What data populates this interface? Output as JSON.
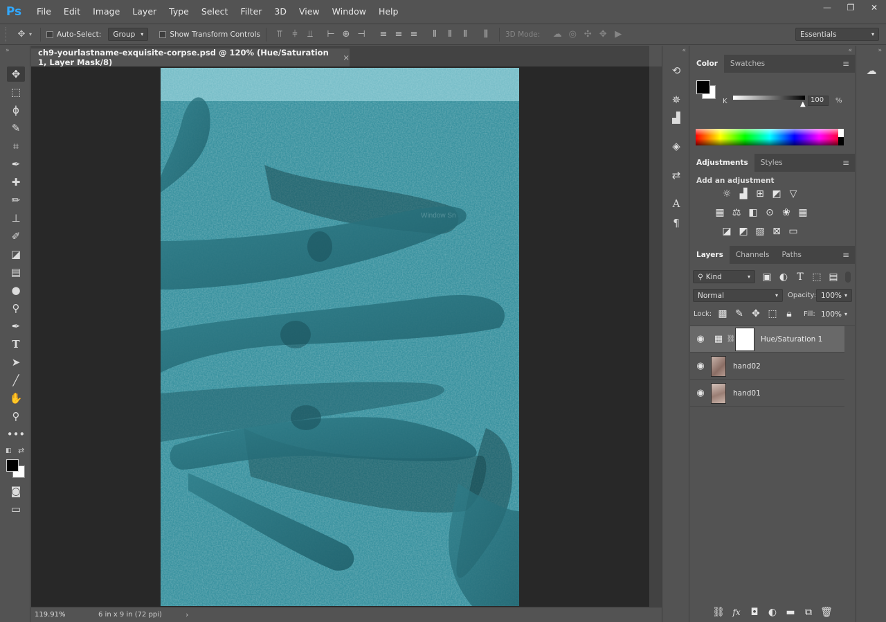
{
  "app": {
    "logo": "Ps"
  },
  "menu": [
    "File",
    "Edit",
    "Image",
    "Layer",
    "Type",
    "Select",
    "Filter",
    "3D",
    "View",
    "Window",
    "Help"
  ],
  "window_controls": {
    "minimize": "—",
    "restore": "❐",
    "close": "✕"
  },
  "options_bar": {
    "auto_select_label": "Auto-Select:",
    "auto_select_value": "Group",
    "show_transform_label": "Show Transform Controls",
    "mode_3d_label": "3D Mode:",
    "workspace": "Essentials"
  },
  "document": {
    "tab_title": "ch9-yourlastname-exquisite-corpse.psd @ 120% (Hue/Saturation 1, Layer Mask/8)",
    "close_glyph": "×",
    "zoom": "119.91%",
    "doc_info": "6 in x 9 in (72 ppi)",
    "watermark_fragment": "Window Sn"
  },
  "color_panel": {
    "tabs": [
      "Color",
      "Swatches"
    ],
    "channel_label": "K",
    "value": "100",
    "unit": "%"
  },
  "adjustments_panel": {
    "tabs": [
      "Adjustments",
      "Styles"
    ],
    "heading": "Add an adjustment"
  },
  "layers_panel": {
    "tabs": [
      "Layers",
      "Channels",
      "Paths"
    ],
    "filter_kind": "Kind",
    "blend_mode": "Normal",
    "opacity_label": "Opacity:",
    "opacity_value": "100%",
    "lock_label": "Lock:",
    "fill_label": "Fill:",
    "fill_value": "100%",
    "layers": [
      {
        "name": "Hue/Saturation 1",
        "selected": true
      },
      {
        "name": "hand02",
        "selected": false
      },
      {
        "name": "hand01",
        "selected": false
      }
    ],
    "footer_fx": "fx"
  },
  "colors": {
    "ui_bg": "#535353",
    "canvas_teal": "#3b9aa8",
    "accent_blue": "#31a8ff"
  }
}
